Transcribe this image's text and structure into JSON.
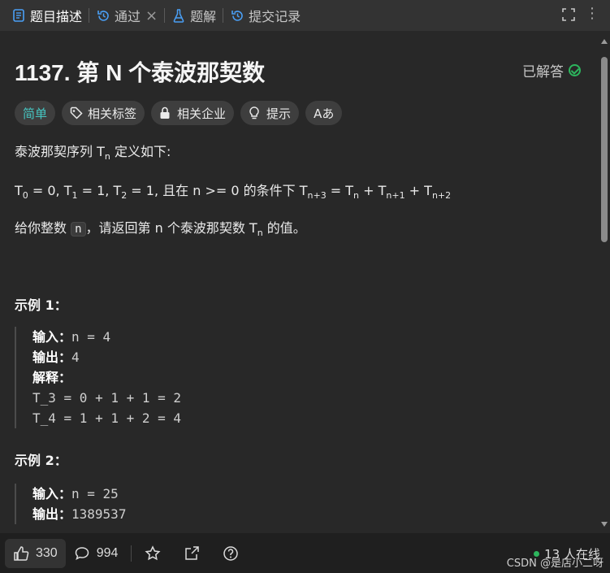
{
  "tabs": [
    {
      "label": "题目描述",
      "icon": "description-icon",
      "active": true
    },
    {
      "label": "通过",
      "icon": "history-icon",
      "active": false
    },
    {
      "label": "题解",
      "icon": "flask-icon",
      "active": false
    },
    {
      "label": "提交记录",
      "icon": "history-icon",
      "active": false
    }
  ],
  "problem": {
    "title": "1137. 第 N 个泰波那契数",
    "status": "已解答",
    "chips": [
      {
        "label": "简单",
        "icon": ""
      },
      {
        "label": "相关标签",
        "icon": "tag-icon"
      },
      {
        "label": "相关企业",
        "icon": "lock-icon"
      },
      {
        "label": "提示",
        "icon": "bulb-icon"
      },
      {
        "label": "Aあ",
        "icon": ""
      }
    ],
    "desc1_prefix": "泰波那契序列 T",
    "desc1_sub": "n",
    "desc1_suffix": " 定义如下: ",
    "desc2": {
      "t0": "T",
      "t0_sub": "0",
      "t0_val": " = 0, ",
      "t1": "T",
      "t1_sub": "1",
      "t1_val": " = 1, ",
      "t2": "T",
      "t2_sub": "2",
      "t2_val": " = 1, 且在 n >= 0 的条件下 ",
      "t3": "T",
      "t3_sub": "n+3",
      "t3_eq": " = ",
      "t4": "T",
      "t4_sub": "n",
      "plus1": " + ",
      "t5": "T",
      "t5_sub": "n+1",
      "plus2": " + ",
      "t6": "T",
      "t6_sub": "n+2"
    },
    "desc3_prefix": "给你整数 ",
    "desc3_code": "n",
    "desc3_mid": "，请返回第 n 个泰波那契数 T",
    "desc3_sub": "n",
    "desc3_suffix": " 的值。",
    "example1": {
      "heading": "示例 1：",
      "input_label": "输入：",
      "input_value": "n = 4",
      "output_label": "输出：",
      "output_value": "4",
      "explain_label": "解释：",
      "explain_lines": [
        "T_3 = 0 + 1 + 1 = 2",
        "T_4 = 1 + 1 + 2 = 4"
      ]
    },
    "example2": {
      "heading": "示例 2：",
      "input_label": "输入：",
      "input_value": "n = 25",
      "output_label": "输出：",
      "output_value": "1389537"
    }
  },
  "bottom": {
    "likes": "330",
    "comments": "994",
    "online": "13 人在线",
    "watermark": "CSDN @是店小二呀"
  },
  "colors": {
    "accent_easy": "#46c6c2",
    "solved_green": "#2db55d"
  }
}
